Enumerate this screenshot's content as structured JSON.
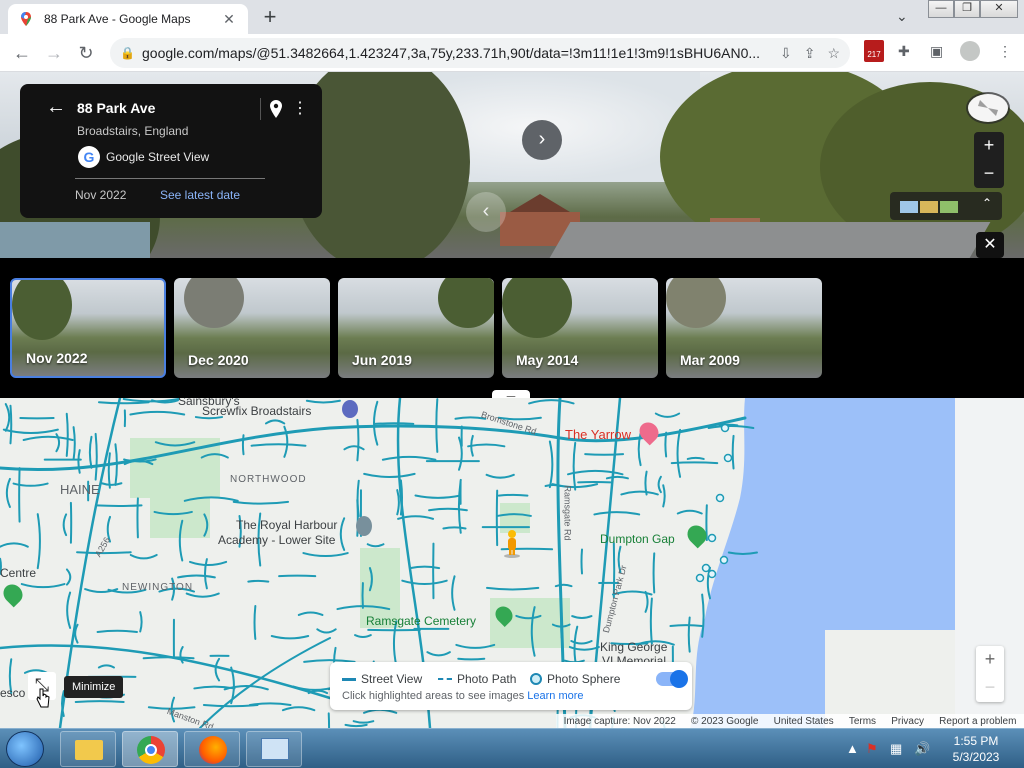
{
  "browser": {
    "tab_title": "88 Park Ave - Google Maps",
    "url": "google.com/maps/@51.3482664,1.423247,3a,75y,233.71h,90t/data=!3m11!1e1!3m9!1sBHU6AN0...",
    "extension_badge": "217"
  },
  "street_view": {
    "title": "88 Park Ave",
    "subtitle": "Broadstairs, England",
    "provider": "Google Street View",
    "current_date": "Nov 2022",
    "latest_link": "See latest date",
    "accent": "#8ab4f8"
  },
  "timeline": [
    {
      "label": "Nov 2022",
      "active": true
    },
    {
      "label": "Dec 2020",
      "active": false
    },
    {
      "label": "Jun 2019",
      "active": false
    },
    {
      "label": "May 2014",
      "active": false
    },
    {
      "label": "Mar 2009",
      "active": false
    }
  ],
  "map": {
    "labels": {
      "sainsburys": "Sainsbury's",
      "screwfix": "Screwfix Broadstairs",
      "bromstone": "Bromstone Rd",
      "the_yarrow": "The Yarrow",
      "haine": "HAINE",
      "northwood": "NORTHWOOD",
      "academy_1": "The Royal Harbour",
      "academy_2": "Academy - Lower Site",
      "ramsgate_rd": "Ramsgate Rd",
      "dumpton_gap": "Dumpton Gap",
      "centre": "Centre",
      "newington": "NEWINGTON",
      "dumpton_park": "Dumpton Park Dr",
      "cemetery": "Ramsgate Cemetery",
      "king_george_1": "King George",
      "king_george_2": "VI Memorial",
      "a256": "A256",
      "manston": "Manston Rd",
      "tesco": "esco"
    },
    "legend": {
      "street_view": "Street View",
      "photo_path": "Photo Path",
      "photo_sphere": "Photo Sphere",
      "hint": "Click highlighted areas to see images",
      "learn_more": "Learn more",
      "toggle_on": true
    },
    "tooltip": "Minimize",
    "footer": {
      "image_capture": "Image capture: Nov 2022",
      "copyright": "© 2023 Google",
      "region": "United States",
      "terms": "Terms",
      "privacy": "Privacy",
      "report": "Report a problem"
    },
    "street_color": "#1e9bb5",
    "water_color": "#9cc0f9"
  },
  "taskbar": {
    "time": "1:55 PM",
    "date": "5/3/2023"
  }
}
